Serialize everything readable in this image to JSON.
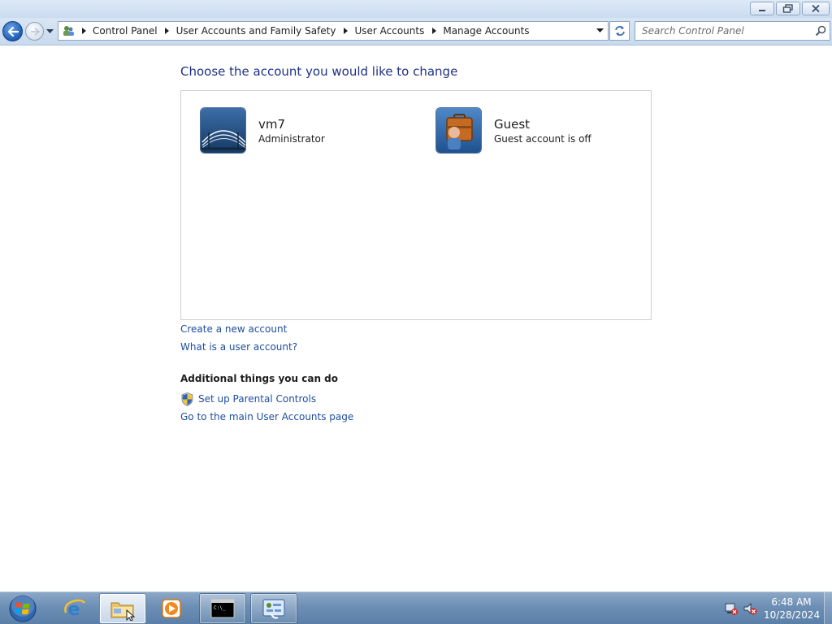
{
  "window": {
    "controls": [
      "minimize",
      "maximize",
      "close"
    ]
  },
  "navigation": {
    "breadcrumbs": [
      "Control Panel",
      "User Accounts and Family Safety",
      "User Accounts",
      "Manage Accounts"
    ],
    "search_placeholder": "Search Control Panel"
  },
  "main": {
    "title": "Choose the account you would like to change",
    "accounts": [
      {
        "name": "vm7",
        "type": "Administrator",
        "icon": "bridge-avatar-icon"
      },
      {
        "name": "Guest",
        "type": "Guest account is off",
        "icon": "guest-briefcase-icon"
      }
    ],
    "links": {
      "create": "Create a new account",
      "what_is": "What is a user account?"
    },
    "additional": {
      "heading": "Additional things you can do",
      "parental": "Set up Parental Controls",
      "main_page": "Go to the main User Accounts page"
    }
  },
  "taskbar": {
    "items": [
      "start-orb",
      "internet-explorer",
      "windows-explorer",
      "media-player",
      "command-prompt",
      "control-panel"
    ],
    "clock": {
      "time": "6:48 AM",
      "date": "10/28/2024"
    }
  },
  "colors": {
    "title_blue": "#1e3287",
    "link_blue": "#1e4ea0",
    "taskbar": "#6d8fb5"
  }
}
